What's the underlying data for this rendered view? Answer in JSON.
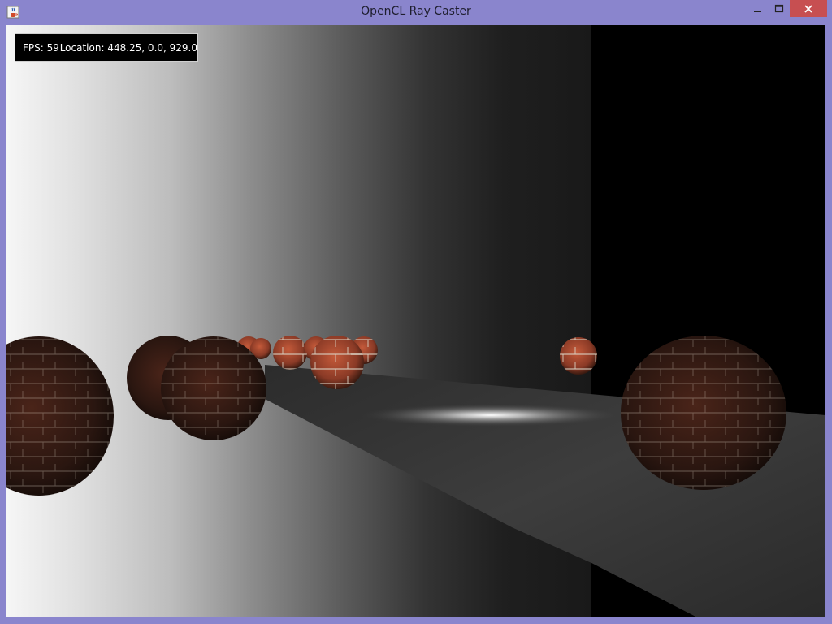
{
  "window": {
    "title": "OpenCL Ray Caster",
    "app_icon": "java-cup-icon",
    "controls": [
      "minimize-icon",
      "maximize-icon",
      "close-icon"
    ]
  },
  "hud": {
    "fps_label": "FPS: 59",
    "location_label": "Location: 448.25, 0.0, 929.0"
  },
  "scene": {
    "sphere_texture": "brick",
    "colors": {
      "brick": "#8a3a26",
      "mortar": "#d8cfc0",
      "floor": "#3a3a3a",
      "wall_light": "#f6f6f6",
      "wall_dark": "#191919"
    }
  }
}
